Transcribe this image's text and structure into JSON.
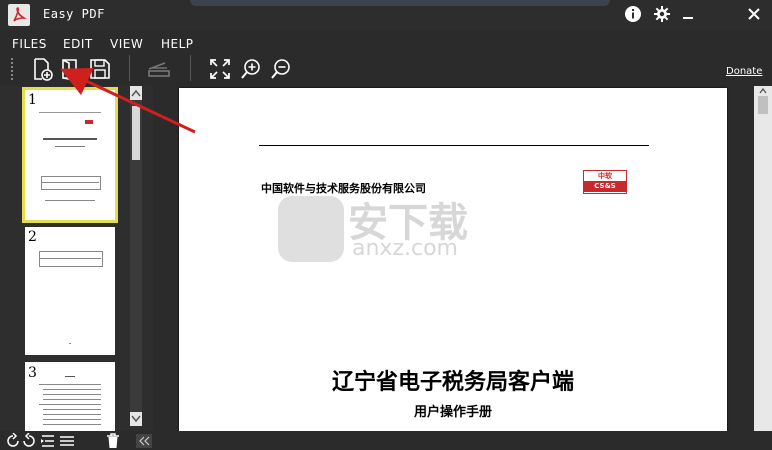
{
  "app": {
    "title": "Easy PDF"
  },
  "menu": {
    "items": [
      "FILES",
      "EDIT",
      "VIEW",
      "HELP"
    ]
  },
  "toolbar": {
    "donate_label": "Donate"
  },
  "thumbnails": [
    {
      "number": "1",
      "selected": true
    },
    {
      "number": "2",
      "selected": false
    },
    {
      "number": "3",
      "selected": false
    }
  ],
  "document": {
    "company": "中国软件与技术服务股份有限公司",
    "logo_top": "中软",
    "logo_bottom": "CS&S",
    "title": "辽宁省电子税务局客户端",
    "subtitle": "用户操作手册"
  },
  "watermark": {
    "text": "安下载",
    "sub": "anxz.com"
  },
  "colors": {
    "accent_pdf": "#c9282d",
    "selection": "#e3de4e",
    "annotation_arrow": "#d0201e"
  }
}
